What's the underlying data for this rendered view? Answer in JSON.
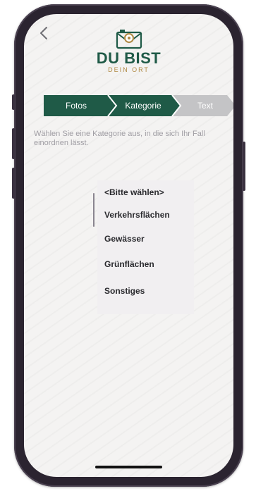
{
  "app": {
    "logo_title": "DU BIST",
    "logo_subtitle": "DEIN ORT"
  },
  "nav": {
    "back_icon": "chevron-left-icon"
  },
  "steps": [
    {
      "label": "Fotos",
      "state": "completed"
    },
    {
      "label": "Kategorie",
      "state": "active"
    },
    {
      "label": "Text",
      "state": "pending"
    }
  ],
  "instruction": "Wählen Sie eine Kategorie aus, in die sich Ihr Fall einordnen lässt.",
  "picker": {
    "options": [
      "<Bitte wählen>",
      "Verkehrsflächen",
      "Gewässer",
      "Grünflächen",
      "Sonstiges"
    ]
  },
  "colors": {
    "brand_green": "#1f5a47",
    "brand_gold": "#b08a44",
    "step_pending": "#c4c4c6",
    "background": "#f4f3f2"
  }
}
